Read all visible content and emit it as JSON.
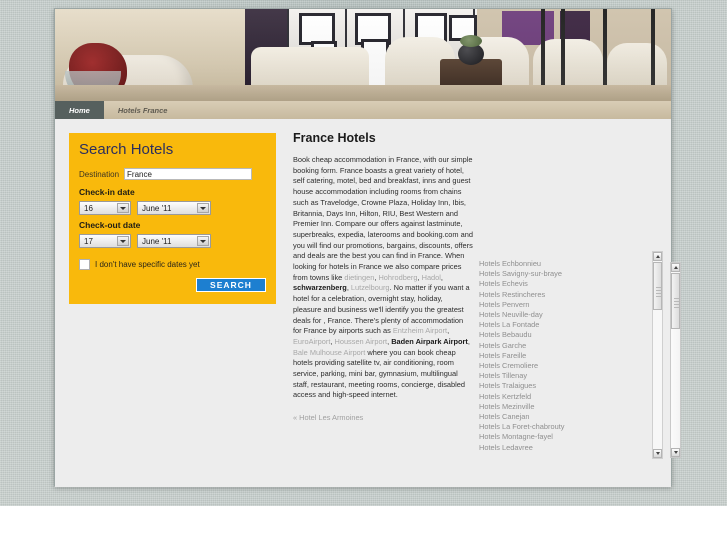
{
  "nav": {
    "tabs": [
      {
        "label": "Home",
        "active": true
      },
      {
        "label": "Hotels France",
        "active": false
      }
    ]
  },
  "search_panel": {
    "title": "Search Hotels",
    "destination_label": "Destination",
    "destination_value": "France",
    "destination_placeholder": "",
    "checkin_label": "Check-in date",
    "checkin_day": "16",
    "checkin_month": "June '11",
    "checkout_label": "Check-out date",
    "checkout_day": "17",
    "checkout_month": "June '11",
    "no_dates_label": "I don't have specific dates yet",
    "search_button": "SEARCH",
    "accent_color": "#f9b90c",
    "button_color": "#1d7fd0",
    "title_color": "#2c2f5e"
  },
  "article": {
    "title": "France Hotels",
    "paragraph_1": "Book cheap accommodation in France, with our simple booking form. France boasts a great variety of hotel, self catering, motel, bed and breakfast, inns and guest house accommodation including rooms from chains such as Travelodge, Crowne Plaza, Holiday Inn, Ibis, Britannia, Days Inn, Hilton, RIU, Best Western and Premier Inn. Compare our offers against lastminute, superbreaks, expedia, laterooms and booking.com and you will find our promotions, bargains, discounts, offers and deals are the best you can find in France. When looking for hotels in France we also compare prices from towns like ",
    "town_1": "dietingen",
    "town_2": "Hohrodberg",
    "town_3": "Hadol",
    "town_4": "schwarzenberg",
    "town_5": "Lutzelbourg",
    "paragraph_2": ". No matter if you want a hotel for a celebration, overnight stay, holiday, pleasure and business we'll identify you the greatest deals for , France. There's plenty of accommodation for France by airports such as ",
    "airport_1": "Entzheim Airport",
    "airport_2": "EuroAirport",
    "airport_3": "Houssen Airport",
    "airport_4": "Baden Airpark Airport",
    "airport_5": "Bale Mulhouse Airport",
    "paragraph_3": " where you can book cheap hotels providing satellite tv, air conditioning, room service, parking, mini bar, gymnasium, multilingual staff, restaurant, meeting rooms, concierge, disabled access and high-speed internet.",
    "hotel_link": "« Hotel Les Armoines"
  },
  "hotels_list": {
    "items": [
      "Hotels Echbonnieu",
      "Hotels Savigny-sur-braye",
      "Hotels Echevis",
      "Hotels Restincheres",
      "Hotels Penvern",
      "Hotels Neuville-day",
      "Hotels La Fontade",
      "Hotels Bebaudu",
      "Hotels Garche",
      "Hotels Fareille",
      "Hotels Cremoliere",
      "Hotels Tillenay",
      "Hotels Tralaigues",
      "Hotels Kertzfeld",
      "Hotels Mezinville",
      "Hotels Canejan",
      "Hotels La Foret-chabrouty",
      "Hotels Montagne-fayel",
      "Hotels Ledavree"
    ]
  },
  "scrollbars": {
    "up_arrow": "scroll-up",
    "down_arrow": "scroll-down"
  }
}
